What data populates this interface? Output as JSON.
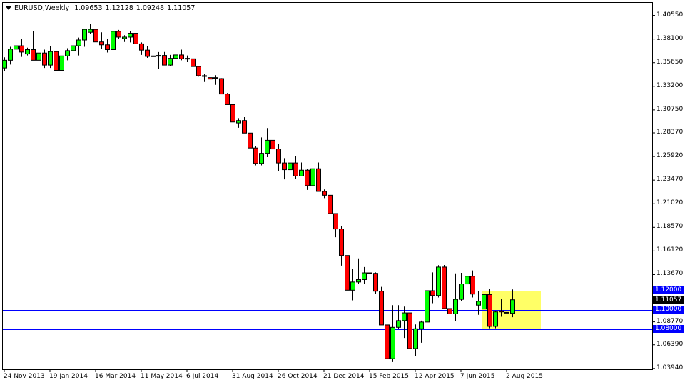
{
  "header": {
    "symbol_timeframe": "EURUSD,Weekly",
    "open": "1.09653",
    "high": "1.12128",
    "low": "1.09248",
    "close": "1.11057"
  },
  "colors": {
    "bull": "#00ff00",
    "bear": "#ff0000",
    "level_line": "#0000ff",
    "zone": "#ffff66"
  },
  "price_axis": {
    "labels": [
      "1.40550",
      "1.38100",
      "1.35650",
      "1.33200",
      "1.30750",
      "1.28370",
      "1.25920",
      "1.23470",
      "1.21020",
      "1.18570",
      "1.16120",
      "1.13670",
      "1.08770",
      "1.06390",
      "1.03940"
    ],
    "level_labels": [
      "1.12000",
      "1.10000",
      "1.08000"
    ],
    "current_price_label": "1.11057"
  },
  "time_axis": {
    "labels": [
      "24 Nov 2013",
      "19 Jan 2014",
      "16 Mar 2014",
      "11 May 2014",
      "6 Jul 2014",
      "31 Aug 2014",
      "26 Oct 2014",
      "21 Dec 2014",
      "15 Feb 2015",
      "12 Apr 2015",
      "7 Jun 2015",
      "2 Aug 2015"
    ]
  },
  "chart_data": {
    "type": "candlestick",
    "title": "EURUSD,Weekly",
    "ylim": [
      1.033,
      1.412
    ],
    "levels": [
      1.12,
      1.1,
      1.08
    ],
    "zone": {
      "from_week": 84,
      "to_week": 94,
      "low": 1.08,
      "high": 1.12
    },
    "first_week": "24 Nov 2013",
    "ohlc": [
      [
        1.351,
        1.362,
        1.348,
        1.359
      ],
      [
        1.359,
        1.373,
        1.3545,
        1.3705
      ],
      [
        1.3705,
        1.3812,
        1.37,
        1.374
      ],
      [
        1.374,
        1.381,
        1.3625,
        1.3675
      ],
      [
        1.3655,
        1.372,
        1.364,
        1.37
      ],
      [
        1.37,
        1.3893,
        1.359,
        1.359
      ],
      [
        1.359,
        1.3685,
        1.357,
        1.3665
      ],
      [
        1.3665,
        1.37,
        1.351,
        1.354
      ],
      [
        1.354,
        1.374,
        1.351,
        1.368
      ],
      [
        1.368,
        1.374,
        1.348,
        1.3485
      ],
      [
        1.3485,
        1.362,
        1.3475,
        1.3635
      ],
      [
        1.3635,
        1.3715,
        1.359,
        1.369
      ],
      [
        1.369,
        1.3775,
        1.364,
        1.374
      ],
      [
        1.374,
        1.3825,
        1.364,
        1.38
      ],
      [
        1.38,
        1.3915,
        1.373,
        1.391
      ],
      [
        1.388,
        1.3967,
        1.386,
        1.391
      ],
      [
        1.391,
        1.3945,
        1.375,
        1.378
      ],
      [
        1.378,
        1.388,
        1.3705,
        1.375
      ],
      [
        1.375,
        1.381,
        1.367,
        1.37
      ],
      [
        1.37,
        1.3905,
        1.37,
        1.389
      ],
      [
        1.389,
        1.3905,
        1.381,
        1.383
      ],
      [
        1.3815,
        1.385,
        1.378,
        1.383
      ],
      [
        1.383,
        1.389,
        1.3775,
        1.387
      ],
      [
        1.387,
        1.3993,
        1.3745,
        1.376
      ],
      [
        1.376,
        1.3775,
        1.3645,
        1.3695
      ],
      [
        1.3695,
        1.3735,
        1.3615,
        1.363
      ],
      [
        1.363,
        1.365,
        1.3585,
        1.3635
      ],
      [
        1.3635,
        1.3675,
        1.3503,
        1.364
      ],
      [
        1.364,
        1.3676,
        1.354,
        1.354
      ],
      [
        1.354,
        1.3645,
        1.353,
        1.361
      ],
      [
        1.361,
        1.366,
        1.358,
        1.3645
      ],
      [
        1.3645,
        1.37,
        1.359,
        1.3605
      ],
      [
        1.3605,
        1.364,
        1.357,
        1.361
      ],
      [
        1.3605,
        1.362,
        1.35,
        1.3525
      ],
      [
        1.3525,
        1.353,
        1.342,
        1.343
      ],
      [
        1.343,
        1.3445,
        1.3365,
        1.3425
      ],
      [
        1.341,
        1.344,
        1.3335,
        1.3395
      ],
      [
        1.341,
        1.3435,
        1.3335,
        1.3405
      ],
      [
        1.34,
        1.3405,
        1.324,
        1.324
      ],
      [
        1.324,
        1.325,
        1.313,
        1.313
      ],
      [
        1.313,
        1.316,
        1.286,
        1.295
      ],
      [
        1.294,
        1.299,
        1.289,
        1.2965
      ],
      [
        1.2965,
        1.3,
        1.286,
        1.2835
      ],
      [
        1.2835,
        1.286,
        1.268,
        1.268
      ],
      [
        1.268,
        1.27,
        1.25,
        1.252
      ],
      [
        1.252,
        1.279,
        1.25,
        1.2625
      ],
      [
        1.2625,
        1.2887,
        1.2585,
        1.276
      ],
      [
        1.276,
        1.284,
        1.26,
        1.267
      ],
      [
        1.267,
        1.272,
        1.244,
        1.2525
      ],
      [
        1.2525,
        1.2575,
        1.2355,
        1.2455
      ],
      [
        1.2455,
        1.2575,
        1.236,
        1.2525
      ],
      [
        1.2525,
        1.26,
        1.236,
        1.239
      ],
      [
        1.239,
        1.253,
        1.239,
        1.245
      ],
      [
        1.245,
        1.246,
        1.2245,
        1.229
      ],
      [
        1.229,
        1.257,
        1.227,
        1.2465
      ],
      [
        1.2465,
        1.253,
        1.2245,
        1.223
      ],
      [
        1.223,
        1.225,
        1.216,
        1.219
      ],
      [
        1.219,
        1.222,
        1.2,
        1.2
      ],
      [
        1.2,
        1.2,
        1.1755,
        1.184
      ],
      [
        1.184,
        1.187,
        1.146,
        1.1565
      ],
      [
        1.1565,
        1.168,
        1.11,
        1.1205
      ],
      [
        1.1205,
        1.1424,
        1.11,
        1.129
      ],
      [
        1.129,
        1.1535,
        1.127,
        1.1315
      ],
      [
        1.1315,
        1.1445,
        1.127,
        1.1385
      ],
      [
        1.1385,
        1.145,
        1.1315,
        1.138
      ],
      [
        1.138,
        1.139,
        1.117,
        1.1195
      ],
      [
        1.1195,
        1.124,
        1.0845,
        1.0845
      ],
      [
        1.0845,
        1.0845,
        1.049,
        1.0495
      ],
      [
        1.0495,
        1.105,
        1.046,
        1.082
      ],
      [
        1.082,
        1.105,
        1.08,
        1.089
      ],
      [
        1.089,
        1.1035,
        1.071,
        1.097
      ],
      [
        1.097,
        1.099,
        1.057,
        1.06
      ],
      [
        1.06,
        1.085,
        1.052,
        1.0805
      ],
      [
        1.0805,
        1.089,
        1.066,
        1.0875
      ],
      [
        1.0875,
        1.129,
        1.082,
        1.12
      ],
      [
        1.12,
        1.139,
        1.107,
        1.115
      ],
      [
        1.115,
        1.1465,
        1.113,
        1.1445
      ],
      [
        1.1445,
        1.1467,
        1.103,
        1.1015
      ],
      [
        1.1015,
        1.105,
        1.082,
        1.096
      ],
      [
        1.096,
        1.138,
        1.0885,
        1.111
      ],
      [
        1.111,
        1.1385,
        1.109,
        1.127
      ],
      [
        1.127,
        1.1435,
        1.113,
        1.135
      ],
      [
        1.135,
        1.141,
        1.113,
        1.1165
      ],
      [
        1.105,
        1.12,
        1.095,
        1.109
      ],
      [
        1.101,
        1.121,
        1.097,
        1.116
      ],
      [
        1.116,
        1.1215,
        1.081,
        1.083
      ],
      [
        1.083,
        1.099,
        1.081,
        1.098
      ],
      [
        1.099,
        1.1115,
        1.093,
        1.098
      ],
      [
        1.0975,
        1.1,
        1.085,
        1.0968
      ],
      [
        1.09653,
        1.12128,
        1.09248,
        1.11057
      ]
    ]
  }
}
